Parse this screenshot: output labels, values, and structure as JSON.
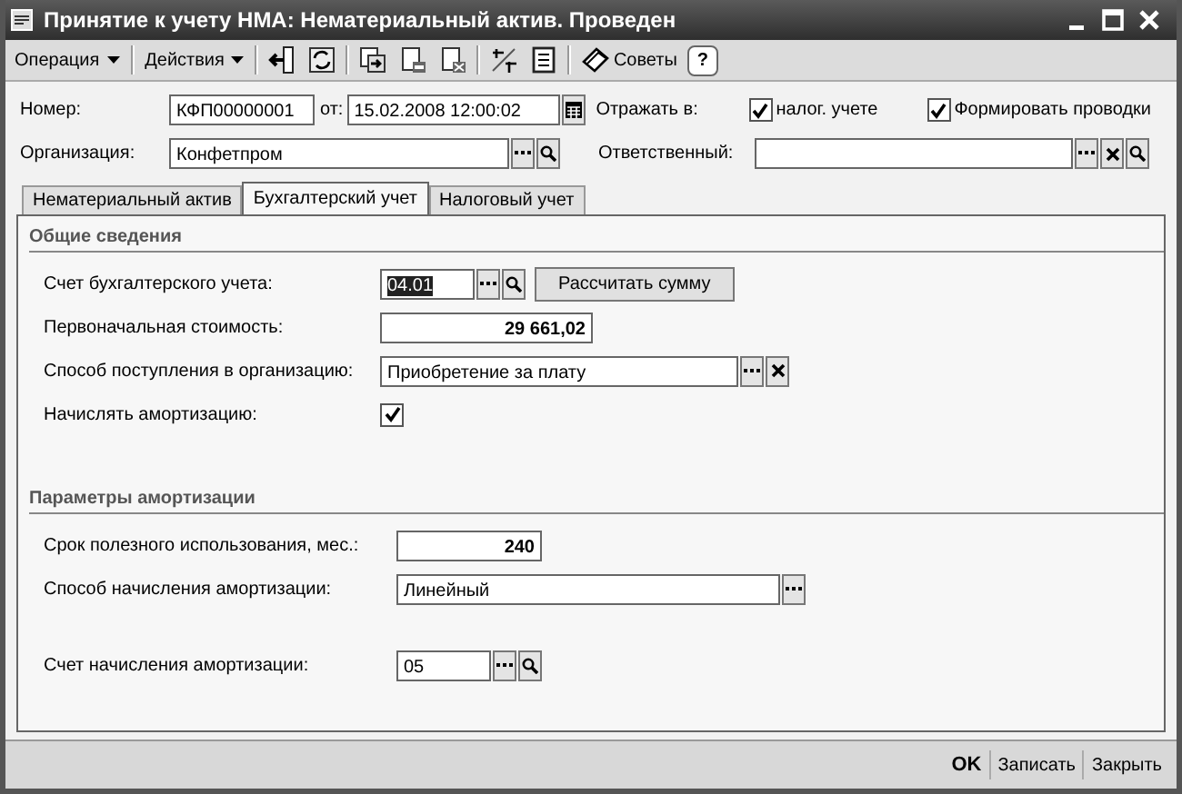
{
  "window": {
    "title": "Принятие к учету НМА: Нематериальный актив. Проведен"
  },
  "toolbar": {
    "menus": [
      {
        "label": "Операция"
      },
      {
        "label": "Действия"
      }
    ],
    "icons": [
      {
        "kind": "enter"
      },
      {
        "kind": "refresh"
      },
      {
        "kind": "copy"
      },
      {
        "kind": "post"
      },
      {
        "kind": "unpost"
      },
      {
        "kind": "dtkt"
      },
      {
        "kind": "report"
      }
    ],
    "advice": "Советы",
    "help": "?"
  },
  "header": {
    "number_label": "Номер:",
    "number": "КФП00000001",
    "date_label": "от:",
    "date": "15.02.2008 12:00:02",
    "reflect_label": "Отражать в:",
    "checkboxes": [
      {
        "label": "налог. учете",
        "checked": true
      },
      {
        "label": "Формировать проводки",
        "checked": true
      }
    ],
    "org_label": "Организация:",
    "org": "Конфетпром",
    "responsible_label": "Ответственный:"
  },
  "tabs": [
    {
      "label": "Нематериальный актив",
      "selected": false
    },
    {
      "label": "Бухгалтерский учет",
      "selected": true
    },
    {
      "label": "Налоговый учет",
      "selected": false
    }
  ],
  "groups": [
    {
      "title": "Общие сведения",
      "rows": [
        {
          "kind": "ref",
          "label": "Счет бухгалтерского учета:",
          "value": "04.01",
          "selected": true,
          "buttons": [
            {
              "kind": "choose"
            },
            {
              "kind": "open"
            }
          ],
          "action": "Рассчитать сумму"
        },
        {
          "kind": "number",
          "label": "Первоначальная стоимость:",
          "value": "29 661,02"
        },
        {
          "kind": "ref",
          "label": "Способ поступления в организацию:",
          "value": "Приобретение за плату",
          "selected": false,
          "buttons": [
            {
              "kind": "choose"
            },
            {
              "kind": "clear"
            }
          ]
        },
        {
          "kind": "checkbox",
          "label": "Начислять амортизацию:",
          "checked": true
        }
      ]
    },
    {
      "title": "Параметры амортизации",
      "rows": [
        {
          "kind": "number",
          "label": "Срок полезного использования, мес.:",
          "value": "240"
        },
        {
          "kind": "ref",
          "label": "Способ начисления амортизации:",
          "value": "Линейный",
          "selected": false,
          "buttons": [
            {
              "kind": "choose"
            }
          ]
        },
        {
          "kind": "ref",
          "label": "Счет начисления амортизации:",
          "value": "05",
          "selected": false,
          "buttons": [
            {
              "kind": "choose"
            },
            {
              "kind": "open"
            }
          ]
        }
      ]
    }
  ],
  "footer": {
    "buttons": [
      {
        "label": "OK",
        "default": true
      },
      {
        "label": "Записать",
        "default": false
      },
      {
        "label": "Закрыть",
        "default": false
      }
    ]
  }
}
